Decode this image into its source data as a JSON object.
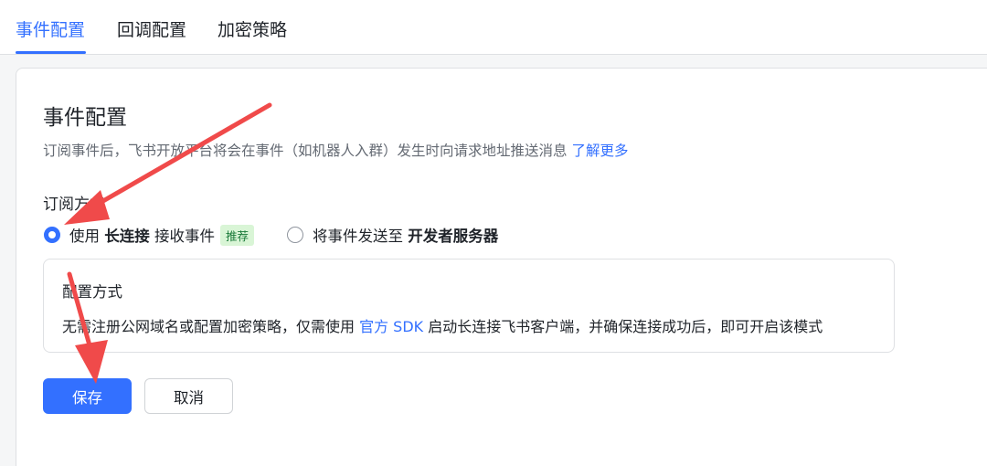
{
  "tabs": [
    {
      "label": "事件配置",
      "active": true
    },
    {
      "label": "回调配置",
      "active": false
    },
    {
      "label": "加密策略",
      "active": false
    }
  ],
  "section": {
    "title": "事件配置",
    "description": "订阅事件后，飞书开放平台将会在事件（如机器人入群）发生时向请求地址推送消息",
    "learn_more": "了解更多"
  },
  "subscription": {
    "label": "订阅方式",
    "option1": {
      "prefix": "使用 ",
      "bold": "长连接",
      "suffix": " 接收事件",
      "tag": "推荐",
      "selected": true
    },
    "option2": {
      "prefix": "将事件发送至 ",
      "bold": "开发者服务器",
      "selected": false
    }
  },
  "config_box": {
    "title": "配置方式",
    "text_before": "无需注册公网域名或配置加密策略，仅需使用 ",
    "link": "官方 SDK",
    "text_after": " 启动长连接飞书客户端，并确保连接成功后，即可开启该模式"
  },
  "buttons": {
    "save": "保存",
    "cancel": "取消"
  },
  "colors": {
    "accent": "#3370ff",
    "annotation_arrow": "#f04a4a",
    "tag_bg": "#d9f5d6",
    "tag_text": "#1a7a39"
  }
}
